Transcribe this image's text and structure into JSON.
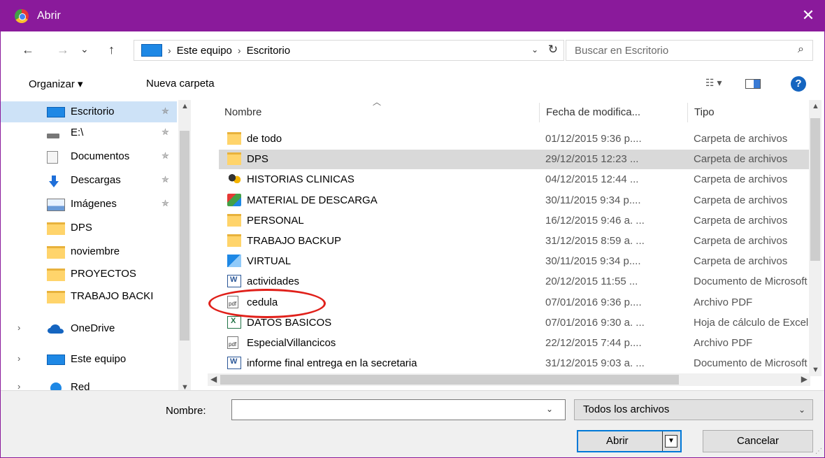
{
  "window": {
    "title": "Abrir",
    "close_glyph": "✕",
    "titlebar_color": "#8a1a9b"
  },
  "address": {
    "back": "←",
    "forward": "→",
    "recent": "⌄",
    "up": "↑",
    "crumbs": [
      "Este equipo",
      "Escritorio"
    ],
    "sep": "›",
    "dropdown": "⌄",
    "refresh": "↻"
  },
  "search": {
    "placeholder": "Buscar en Escritorio",
    "glyph": "⌕"
  },
  "toolbar": {
    "organize": "Organizar ▾",
    "new_folder": "Nueva carpeta",
    "view_glyph": "☷ ▾",
    "help": "?"
  },
  "nav": {
    "items": [
      {
        "label": "Escritorio",
        "icon": "desktop-icon",
        "pinned": true
      },
      {
        "label": "E:\\",
        "icon": "drive-icon",
        "pinned": true
      },
      {
        "label": "Documentos",
        "icon": "document-icon",
        "pinned": true
      },
      {
        "label": "Descargas",
        "icon": "download-icon",
        "pinned": true
      },
      {
        "label": "Imágenes",
        "icon": "pictures-icon",
        "pinned": true
      },
      {
        "label": "DPS",
        "icon": "folder-icon",
        "pinned": false
      },
      {
        "label": "noviembre",
        "icon": "folder-icon",
        "pinned": false
      },
      {
        "label": "PROYECTOS",
        "icon": "folder-icon",
        "pinned": false
      },
      {
        "label": "TRABAJO BACKI",
        "icon": "folder-icon",
        "pinned": false
      },
      {
        "label": "OneDrive",
        "icon": "onedrive-icon",
        "pinned": false
      },
      {
        "label": "Este equipo",
        "icon": "computer-icon",
        "pinned": false
      },
      {
        "label": "Red",
        "icon": "network-icon",
        "pinned": false
      }
    ],
    "pin_glyph": "✯",
    "expand_glyph": "›"
  },
  "columns": {
    "name": "Nombre",
    "date": "Fecha de modifica...",
    "type": "Tipo"
  },
  "files": [
    {
      "name": "de todo",
      "date": "01/12/2015 9:36 p....",
      "type": "Carpeta de archivos",
      "icon": "folder"
    },
    {
      "name": "DPS",
      "date": "29/12/2015 12:23 ...",
      "type": "Carpeta de archivos",
      "icon": "folder"
    },
    {
      "name": "HISTORIAS CLINICAS",
      "date": "04/12/2015 12:44 ...",
      "type": "Carpeta de archivos",
      "icon": "people"
    },
    {
      "name": "MATERIAL DE DESCARGA",
      "date": "30/11/2015 9:34 p....",
      "type": "Carpeta de archivos",
      "icon": "app"
    },
    {
      "name": "PERSONAL",
      "date": "16/12/2015 9:46 a. ...",
      "type": "Carpeta de archivos",
      "icon": "folder"
    },
    {
      "name": "TRABAJO BACKUP",
      "date": "31/12/2015 8:59 a. ...",
      "type": "Carpeta de archivos",
      "icon": "folder"
    },
    {
      "name": "VIRTUAL",
      "date": "30/11/2015 9:34 p....",
      "type": "Carpeta de archivos",
      "icon": "vm"
    },
    {
      "name": "actividades",
      "date": "20/12/2015 11:55 ...",
      "type": "Documento de Microsoft Word",
      "icon": "word"
    },
    {
      "name": "cedula",
      "date": "07/01/2016 9:36 p....",
      "type": "Archivo PDF",
      "icon": "pdf"
    },
    {
      "name": "DATOS BASICOS",
      "date": "07/01/2016 9:30 a. ...",
      "type": "Hoja de cálculo de Excel",
      "icon": "excel"
    },
    {
      "name": "EspecialVillancicos",
      "date": "22/12/2015 7:44 p....",
      "type": "Archivo PDF",
      "icon": "pdf"
    },
    {
      "name": "informe final entrega en la secretaria",
      "date": "31/12/2015 9:03 a. ...",
      "type": "Documento de Microsoft Word",
      "icon": "word"
    }
  ],
  "selected_row": 1,
  "annotation_color": "#e0201a",
  "bottom": {
    "name_label": "Nombre:",
    "name_value": "",
    "dropdown": "⌄",
    "filter": "Todos los archivos",
    "open": "Abrir",
    "open_caret": "▼",
    "cancel": "Cancelar"
  }
}
